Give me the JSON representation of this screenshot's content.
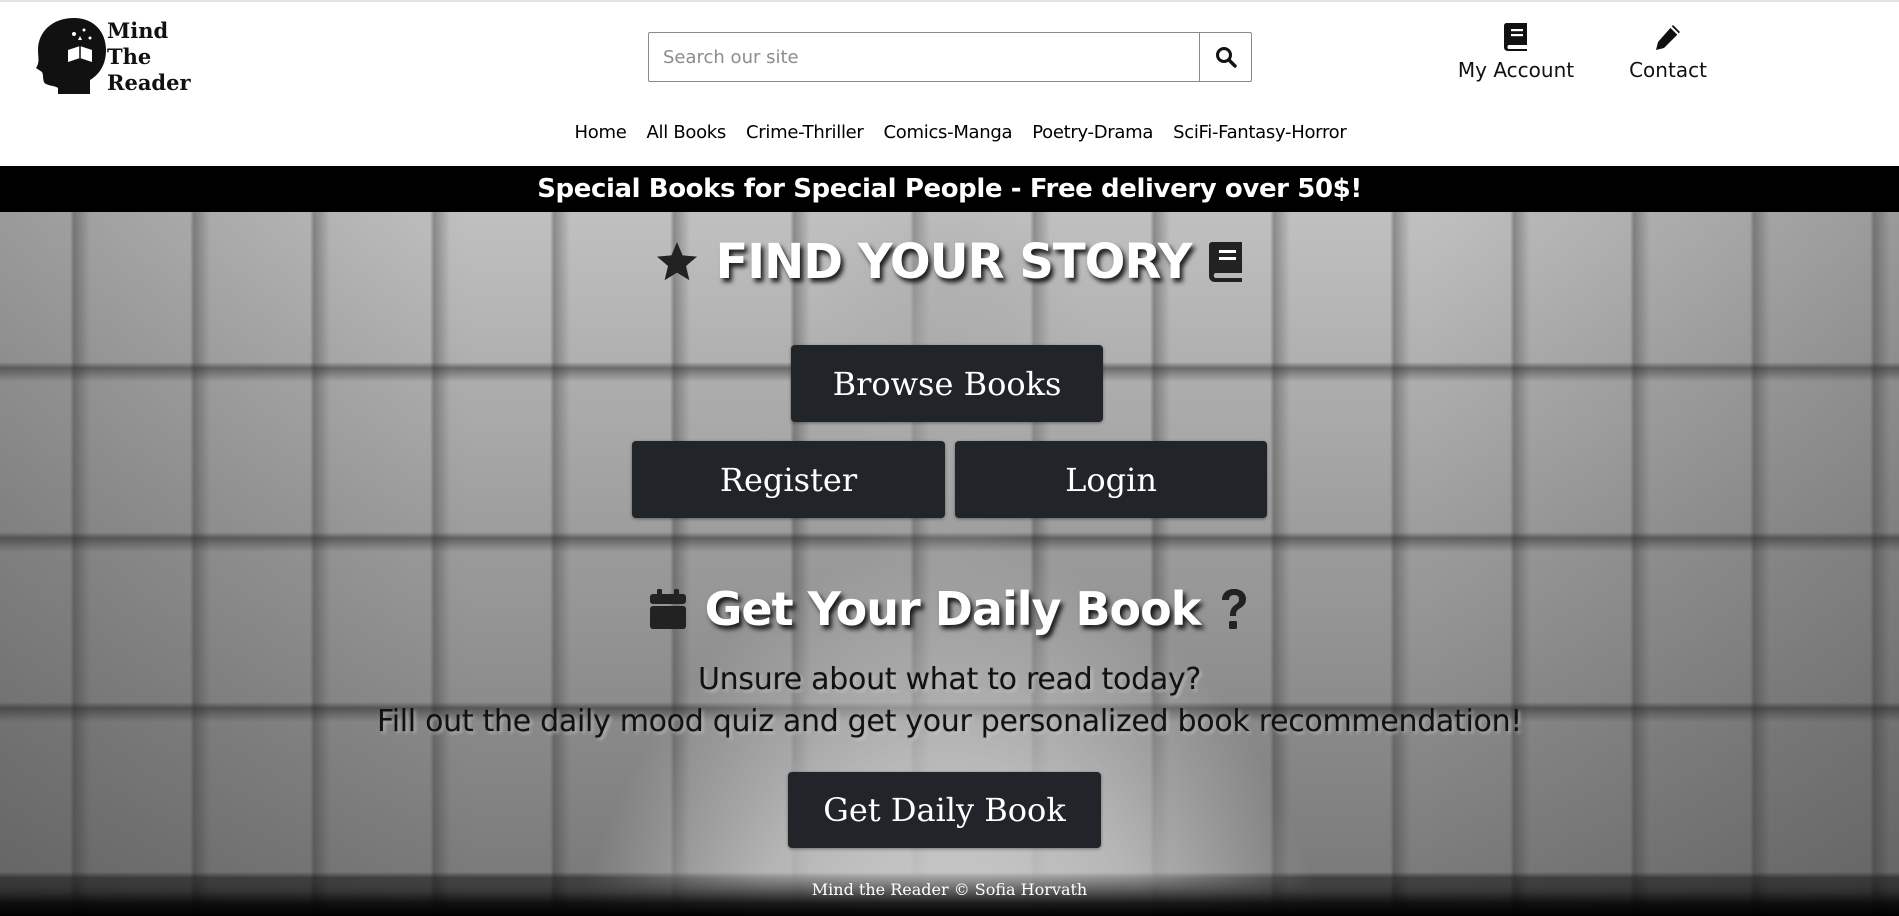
{
  "logo": {
    "line1": "Mind",
    "line2": "The",
    "line3": "Reader"
  },
  "search": {
    "placeholder": "Search our site",
    "icon": "search-icon"
  },
  "header_links": {
    "account_label": "My Account",
    "account_icon": "book-icon",
    "contact_label": "Contact",
    "contact_icon": "pencil-icon"
  },
  "nav": {
    "items": [
      {
        "label": "Home"
      },
      {
        "label": "All Books"
      },
      {
        "label": "Crime-Thriller"
      },
      {
        "label": "Comics-Manga"
      },
      {
        "label": "Poetry-Drama"
      },
      {
        "label": "SciFi-Fantasy-Horror"
      }
    ]
  },
  "banner": {
    "text": "Special Books for Special People - Free delivery over 50$!"
  },
  "hero": {
    "title": "FIND YOUR STORY",
    "title_left_icon": "star-icon",
    "title_right_icon": "book-icon",
    "browse_label": "Browse Books",
    "register_label": "Register",
    "login_label": "Login"
  },
  "daily": {
    "title": "Get Your Daily Book",
    "title_left_icon": "calendar-icon",
    "title_right_icon": "question-icon",
    "line1": "Unsure about what to read today?",
    "line2": "Fill out the daily mood quiz and get your personalized book recommendation!",
    "button_label": "Get Daily Book"
  },
  "footer": {
    "text": "Mind the Reader © Sofia Horvath"
  },
  "colors": {
    "button_bg": "#212529",
    "banner_bg": "#000000",
    "text_white": "#ffffff"
  }
}
